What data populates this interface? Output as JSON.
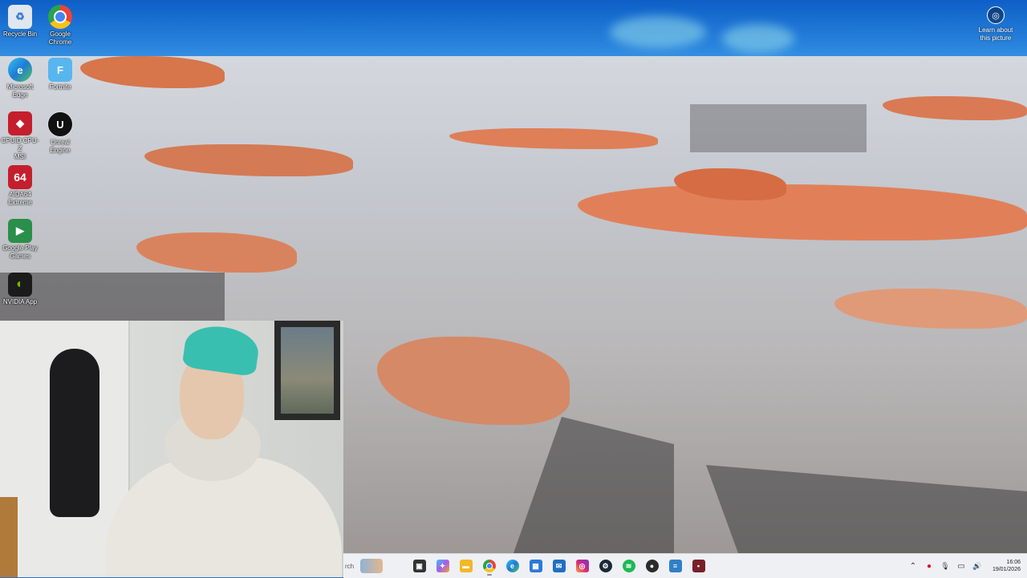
{
  "desktop": {
    "icons": [
      {
        "label": "Recycle Bin",
        "icon": "recycle-bin-icon",
        "color": "#dfe7ef",
        "glyph": "♻"
      },
      {
        "label": "Google\nChrome",
        "icon": "chrome-icon",
        "color": "#e9443a",
        "glyph": "◉"
      },
      {
        "label": "Microsoft\nEdge",
        "icon": "edge-icon",
        "color": "#1aa0d8",
        "glyph": "e"
      },
      {
        "label": "Fortnite",
        "icon": "fortnite-icon",
        "color": "#58b6ef",
        "glyph": "F"
      },
      {
        "label": "CPUID CPU-Z\nMSI",
        "icon": "cpuz-icon",
        "color": "#c41f2c",
        "glyph": "◆"
      },
      {
        "label": "Unreal\nEngine",
        "icon": "unreal-engine-icon",
        "color": "#111111",
        "glyph": "U"
      },
      {
        "label": "AIDA64\nExtreme",
        "icon": "aida64-icon",
        "color": "#c41f2c",
        "glyph": "64"
      },
      {
        "label": "Google Play\nGames",
        "icon": "google-play-games-icon",
        "color": "#2a8f4a",
        "glyph": "▶"
      },
      {
        "label": "NVIDIA App",
        "icon": "nvidia-app-icon",
        "color": "#5aa31f",
        "glyph": "◐"
      }
    ],
    "learn_about": "Learn about\nthis picture"
  },
  "taskbar": {
    "search_placeholder": "rch",
    "apps": [
      {
        "name": "task-view",
        "icon": "task-view-icon",
        "color": "#333333",
        "glyph": "▣"
      },
      {
        "name": "copilot",
        "icon": "copilot-icon",
        "color": "#7a5cf0",
        "glyph": "✦"
      },
      {
        "name": "file-explorer",
        "icon": "file-explorer-icon",
        "color": "#f2b826",
        "glyph": "▬"
      },
      {
        "name": "chrome",
        "icon": "chrome-icon",
        "color": "#e9443a",
        "glyph": "◉",
        "active": true
      },
      {
        "name": "edge",
        "icon": "edge-icon",
        "color": "#1a8fd8",
        "glyph": "e"
      },
      {
        "name": "microsoft-store",
        "icon": "store-icon",
        "color": "#2b79d9",
        "glyph": "▦"
      },
      {
        "name": "outlook",
        "icon": "outlook-icon",
        "color": "#1f6fc4",
        "glyph": "✉"
      },
      {
        "name": "instagram",
        "icon": "instagram-icon",
        "color": "#c3307a",
        "glyph": "◎"
      },
      {
        "name": "steam",
        "icon": "steam-icon",
        "color": "#1b2838",
        "glyph": "⚙"
      },
      {
        "name": "spotify",
        "icon": "spotify-icon",
        "color": "#1db954",
        "glyph": "≋"
      },
      {
        "name": "game-app",
        "icon": "game-icon",
        "color": "#2b2b2b",
        "glyph": "●"
      },
      {
        "name": "notepad",
        "icon": "notepad-icon",
        "color": "#2f7fc7",
        "glyph": "≡"
      },
      {
        "name": "app-red",
        "icon": "app-icon",
        "color": "#7a1f2a",
        "glyph": "▪"
      }
    ],
    "tray": [
      {
        "icon": "chevron-up-icon",
        "glyph": "⌃"
      },
      {
        "icon": "antivirus-icon",
        "glyph": "●"
      },
      {
        "icon": "microphone-icon",
        "glyph": "🎙"
      },
      {
        "icon": "network-icon",
        "glyph": "▭"
      },
      {
        "icon": "volume-icon",
        "glyph": "🔊"
      }
    ],
    "time": "16:06",
    "date": "19/01/2026"
  }
}
